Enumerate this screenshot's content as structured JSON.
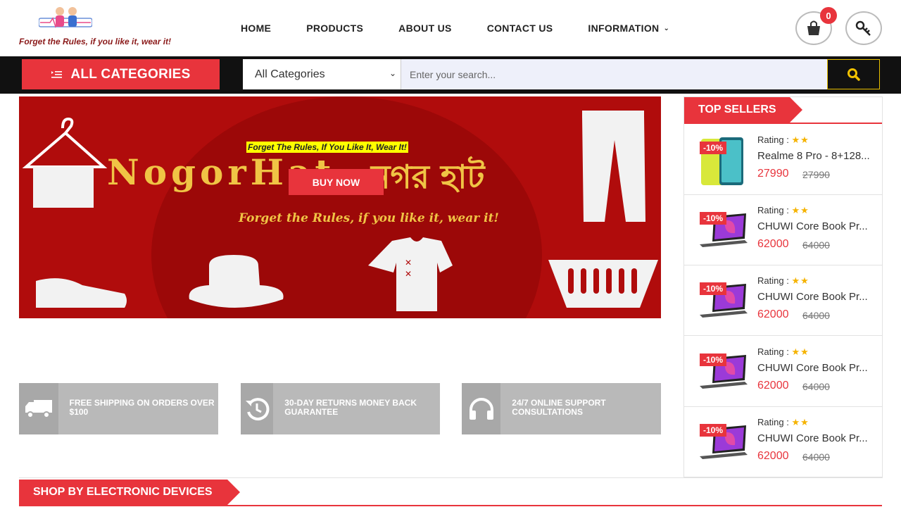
{
  "brand": {
    "tagline": "Forget the Rules, if you like it, wear it!"
  },
  "nav": {
    "items": [
      "HOME",
      "PRODUCTS",
      "ABOUT US",
      "CONTACT US",
      "INFORMATION"
    ]
  },
  "cart": {
    "count": "0"
  },
  "category_bar": {
    "all_categories": "ALL CATEGORIES",
    "select_value": "All Categories",
    "search_placeholder": "Enter your search..."
  },
  "banner": {
    "tag_top": "Forget The Rules, If You Like It, Wear It!",
    "brand_en": "NogorHat",
    "brand_bn": "নগর হাট",
    "buy_now": "BUY NOW",
    "slogan": "Forget the Rules, if you like it, wear it!"
  },
  "features": [
    {
      "text": "FREE SHIPPING ON ORDERS OVER $100",
      "icon": "truck-icon"
    },
    {
      "text": "30-DAY RETURNS MONEY BACK GUARANTEE",
      "icon": "returns-icon"
    },
    {
      "text": "24/7 ONLINE SUPPORT CONSULTATIONS",
      "icon": "headset-icon"
    }
  ],
  "top_sellers": {
    "title": "TOP SELLERS",
    "products": [
      {
        "discount": "-10%",
        "rating_label": "Rating :",
        "stars": "★★",
        "name": "Realme 8 Pro - 8+128...",
        "price": "27990",
        "old_price": "27990",
        "thumb": "phone"
      },
      {
        "discount": "-10%",
        "rating_label": "Rating :",
        "stars": "★★",
        "name": "CHUWI Core Book Pr...",
        "price": "62000",
        "old_price": "64000",
        "thumb": "laptop"
      },
      {
        "discount": "-10%",
        "rating_label": "Rating :",
        "stars": "★★",
        "name": "CHUWI Core Book Pr...",
        "price": "62000",
        "old_price": "64000",
        "thumb": "laptop"
      },
      {
        "discount": "-10%",
        "rating_label": "Rating :",
        "stars": "★★",
        "name": "CHUWI Core Book Pr...",
        "price": "62000",
        "old_price": "64000",
        "thumb": "laptop"
      },
      {
        "discount": "-10%",
        "rating_label": "Rating :",
        "stars": "★★",
        "name": "CHUWI Core Book Pr...",
        "price": "62000",
        "old_price": "64000",
        "thumb": "laptop"
      }
    ]
  },
  "shop_section": {
    "title": "SHOP BY ELECTRONIC DEVICES"
  },
  "colors": {
    "accent": "#e8343c",
    "dark": "#111111",
    "banner": "#b00c0c",
    "gold": "#f0c445"
  }
}
